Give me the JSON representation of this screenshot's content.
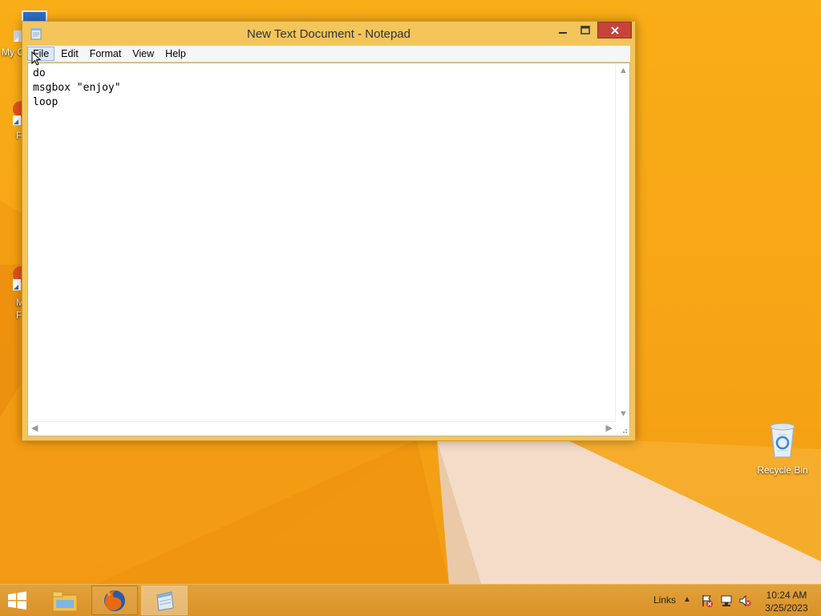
{
  "window": {
    "title": "New Text Document - Notepad",
    "menu": [
      "File",
      "Edit",
      "Format",
      "View",
      "Help"
    ],
    "active_menu": "File"
  },
  "editor": {
    "lines": [
      "do",
      "msgbox \"enjoy\"",
      "loop"
    ]
  },
  "desktop": {
    "icons": [
      {
        "label": "My C",
        "icon": "computer-icon"
      },
      {
        "label": "F",
        "icon": "firefox-shortcut-icon"
      },
      {
        "label": "M",
        "label2": "F",
        "icon": "firefox-shortcut-icon"
      }
    ],
    "recycle_bin": {
      "label": "Recycle Bin",
      "icon": "recycle-bin-icon"
    }
  },
  "taskbar": {
    "links_label": "Links",
    "time": "10:24 AM",
    "date": "3/25/2023",
    "apps": [
      {
        "name": "File Explorer",
        "icon": "file-explorer-icon"
      },
      {
        "name": "Firefox",
        "icon": "firefox-icon"
      },
      {
        "name": "Notepad",
        "icon": "notepad-icon"
      }
    ]
  },
  "colors": {
    "desktop_bg": "#f7a516",
    "window_frame": "#f3c55a",
    "close_button": "#c7433a",
    "taskbar": "#d99228"
  }
}
